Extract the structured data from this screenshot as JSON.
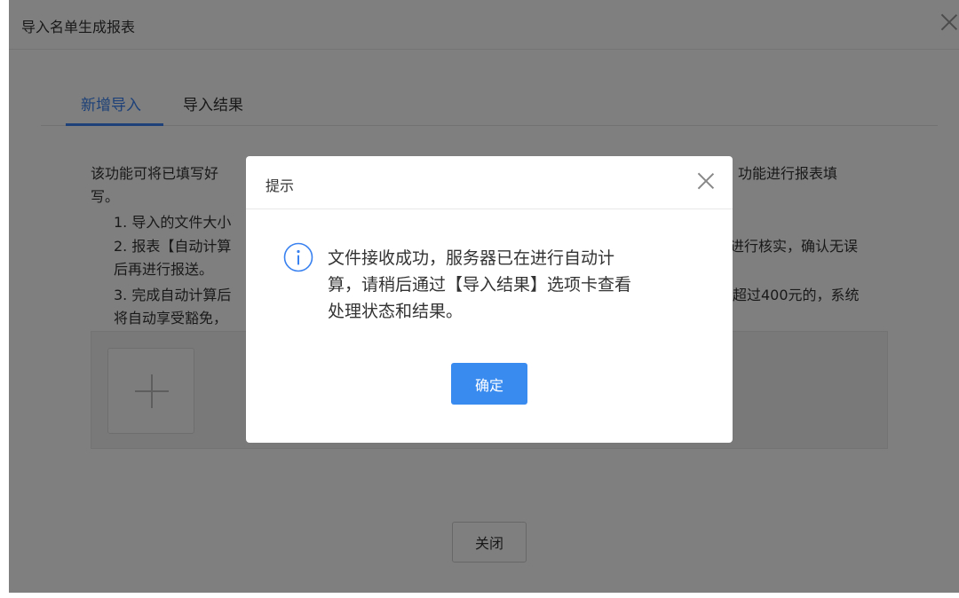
{
  "window": {
    "title": "导入名单生成报表"
  },
  "tabs": [
    {
      "label": "新增导入",
      "active": true
    },
    {
      "label": "导入结果",
      "active": false
    }
  ],
  "description": {
    "intro_line1_left": "该功能可将已填写好",
    "intro_line1_right": "】功能进行报表填",
    "intro_line2": "写。",
    "item1_left": "1. 导入的文件大小",
    "item2_left": "2. 报表【自动计算",
    "item2_right": "进行核实，确认无误",
    "item2_cont": "后再进行报送。",
    "item3_left": "3. 完成自动计算后",
    "item3_right": "超过400元的，系统",
    "item3_cont_left": "将自动享受豁免，"
  },
  "footer": {
    "close_label": "关闭"
  },
  "dialog": {
    "title": "提示",
    "message_lines": [
      "文件接收成功，服务器已在进行自动计",
      "算，请稍后通过【导入结果】选项卡查看",
      "处理状态和结果。"
    ],
    "ok_label": "确定"
  },
  "colors": {
    "accent": "#3a82f0",
    "button_primary": "#3a8bf0",
    "overlay": "rgba(0,0,0,0.5)"
  }
}
